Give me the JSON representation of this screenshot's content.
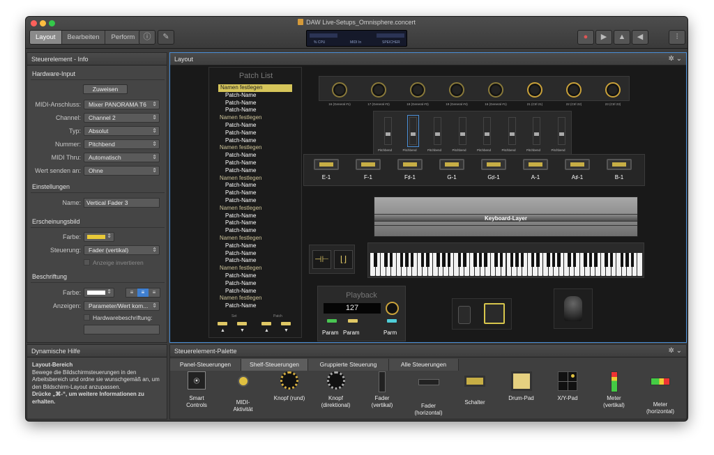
{
  "window": {
    "title": "DAW Live-Setups_Omnisphere.concert"
  },
  "toolbar": {
    "tabs": [
      "Layout",
      "Bearbeiten",
      "Perform"
    ],
    "active_tab": "Layout",
    "lcd": {
      "cpu": "% CPU",
      "midi": "MIDI In",
      "speicher": "SPEICHER"
    },
    "icons": [
      "info-icon",
      "pencil-icon",
      "record-icon",
      "play-icon",
      "metronome-icon",
      "speaker-icon",
      "mixer-icon"
    ]
  },
  "inspector": {
    "title": "Steuerelement - Info",
    "hardware": {
      "header": "Hardware-Input",
      "assign": "Zuweisen",
      "rows": [
        {
          "label": "MIDI-Anschluss:",
          "value": "Mixer PANORAMA T6"
        },
        {
          "label": "Channel:",
          "value": "Channel 2"
        },
        {
          "label": "Typ:",
          "value": "Absolut"
        },
        {
          "label": "Nummer:",
          "value": "Pitchbend"
        },
        {
          "label": "MIDI Thru:",
          "value": "Automatisch"
        },
        {
          "label": "Wert senden an:",
          "value": "Ohne"
        }
      ]
    },
    "einstellungen": {
      "header": "Einstellungen",
      "name_label": "Name:",
      "name_value": "Vertical Fader 3"
    },
    "erscheinung": {
      "header": "Erscheinungsbild",
      "farbe_label": "Farbe:",
      "farbe_color": "#e8c938",
      "steuerung_label": "Steuerung:",
      "steuerung_value": "Fader (vertikal)",
      "invert": "Anzeige invertieren"
    },
    "beschriftung": {
      "header": "Beschriftung",
      "farbe_label": "Farbe:",
      "farbe_color": "#ffffff",
      "anzeigen_label": "Anzeigen:",
      "anzeigen_value": "Parameter/Wert kom...",
      "hw_label": "Hardwarebeschriftung:"
    }
  },
  "help": {
    "title": "Dynamische Hilfe",
    "heading": "Layout-Bereich",
    "body": "Bewege die Bildschirmsteuerungen in den Arbeitsbereich und ordne sie wunschgemäß an, um den Bildschirm-Layout anzupassen.",
    "hint": "Drücke „⌘-“, um weitere Informationen zu erhalten."
  },
  "layout": {
    "title": "Layout",
    "patch_list": {
      "header": "Patch List",
      "items": [
        "Namen festlegen",
        "Patch-Name",
        "Patch-Name",
        "Patch-Name",
        "Namen festlegen",
        "Patch-Name",
        "Patch-Name",
        "Patch-Name",
        "Namen festlegen",
        "Patch-Name",
        "Patch-Name",
        "Patch-Name",
        "Namen festlegen",
        "Patch-Name",
        "Patch-Name",
        "Patch-Name",
        "Namen festlegen",
        "Patch-Name",
        "Patch-Name",
        "Patch-Name",
        "Namen festlegen",
        "Patch-Name",
        "Patch-Name",
        "Patch-Name",
        "Namen festlegen",
        "Patch-Name",
        "Patch-Name",
        "Patch-Name",
        "Namen festlegen",
        "Patch-Name"
      ],
      "set_label": "Set",
      "patch_label": "Patch"
    },
    "knobs": [
      "16 (General #1)",
      "17 (General #2)",
      "18 (General #3)",
      "19 (General #4)",
      "16 (General #1)",
      "21 (Ctrl 21)",
      "22 (Ctrl 22)",
      "23 (Ctrl 23)"
    ],
    "faders": [
      "Pitchbend",
      "Pitchbend",
      "Pitchbend",
      "Pitchbend",
      "Pitchbend",
      "Pitchbend",
      "Pitchbend",
      "Pitchbend"
    ],
    "switches": [
      "E-1",
      "F-1",
      "F♯-1",
      "G-1",
      "G♯-1",
      "A-1",
      "A♯-1",
      "B-1"
    ],
    "keyboard_layer": "Keyboard-Layer",
    "playback": {
      "title": "Playback",
      "value": "127",
      "labels": [
        "Param",
        "Param",
        "Parm"
      ]
    }
  },
  "palette": {
    "title": "Steuerelement-Palette",
    "tabs": [
      "Panel-Steuerungen",
      "Shelf-Steuerungen",
      "Gruppierte Steuerung",
      "Alle Steuerungen"
    ],
    "active_tab": "Shelf-Steuerungen",
    "items": [
      {
        "label": "Smart\nControls",
        "icon": "smart-controls-icon"
      },
      {
        "label": "MIDI-\nAktivität",
        "icon": "midi-activity-icon"
      },
      {
        "label": "Knopf (rund)",
        "icon": "knob-round-icon"
      },
      {
        "label": "Knopf\n(direktional)",
        "icon": "knob-directional-icon"
      },
      {
        "label": "Fader\n(vertikal)",
        "icon": "fader-vertical-icon"
      },
      {
        "label": "Fader\n(horizontal)",
        "icon": "fader-horizontal-icon"
      },
      {
        "label": "Schalter",
        "icon": "switch-icon"
      },
      {
        "label": "Drum-Pad",
        "icon": "drum-pad-icon"
      },
      {
        "label": "X/Y-Pad",
        "icon": "xy-pad-icon"
      },
      {
        "label": "Meter\n(vertikal)",
        "icon": "meter-vertical-icon"
      },
      {
        "label": "Meter\n(horizontal)",
        "icon": "meter-horizontal-icon"
      }
    ]
  }
}
